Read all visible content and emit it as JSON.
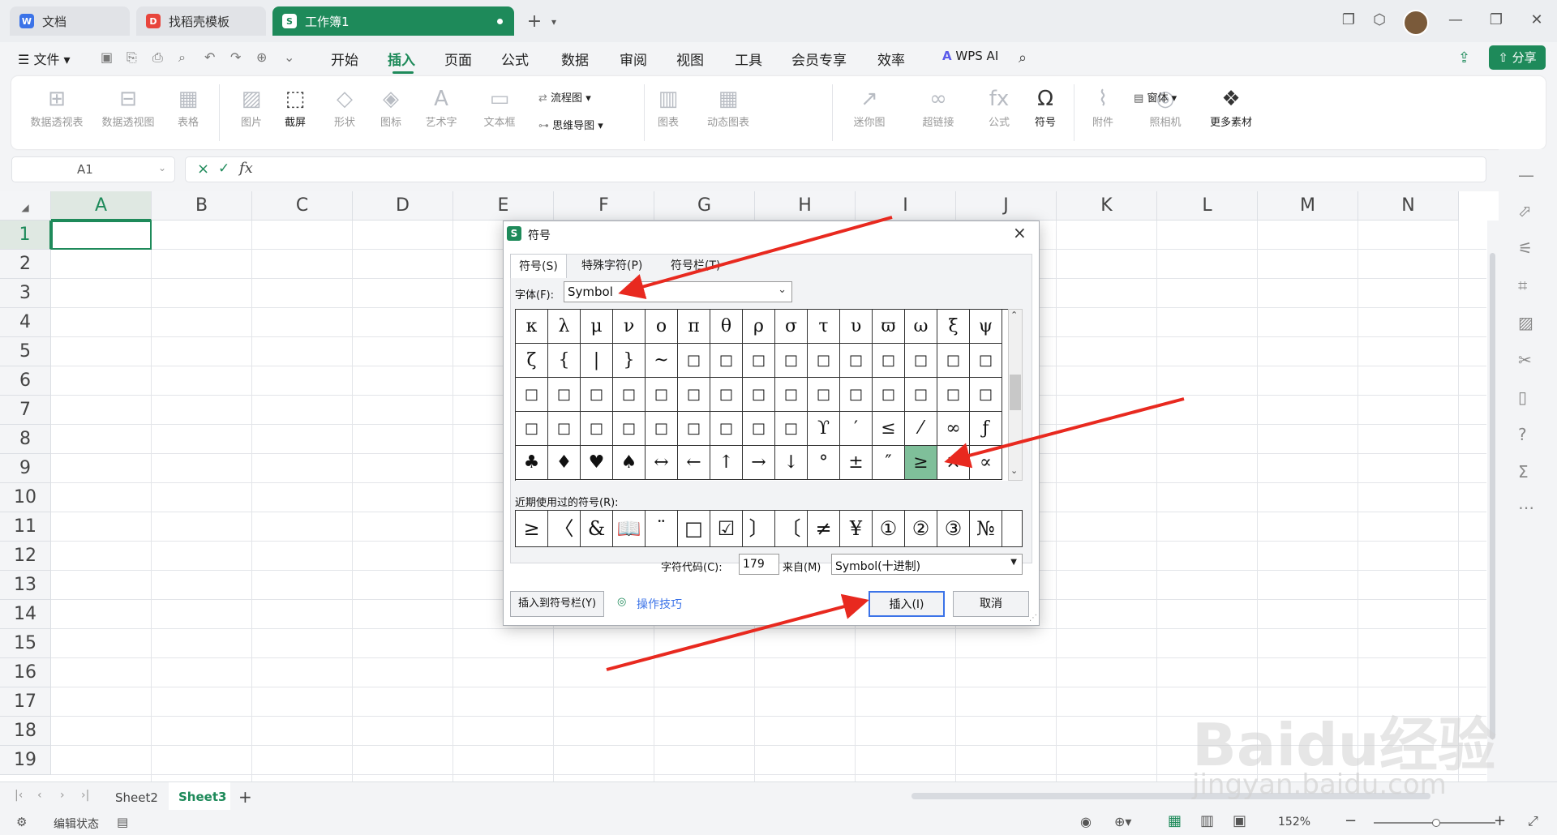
{
  "window": {
    "tabs": [
      {
        "label": "文档",
        "icon_color": "#3b73e8",
        "icon_text": "W"
      },
      {
        "label": "找稻壳模板",
        "icon_color": "#e8453c",
        "icon_text": "D"
      },
      {
        "label": "工作簿1",
        "icon_color": "#1e8a5a",
        "icon_text": "S"
      }
    ],
    "new_tab": "+"
  },
  "menu": {
    "file": "文件",
    "items": [
      "开始",
      "插入",
      "页面",
      "公式",
      "数据",
      "审阅",
      "视图",
      "工具",
      "会员专享",
      "效率"
    ],
    "active": "插入",
    "wps_ai": "WPS AI",
    "share": "分享"
  },
  "ribbon": {
    "buttons": [
      "数据透视表",
      "数据透视图",
      "表格",
      "图片",
      "截屏",
      "形状",
      "图标",
      "艺术字",
      "文本框",
      "图表",
      "动态图表",
      "迷你图",
      "超链接",
      "公式",
      "符号",
      "附件",
      "照相机",
      "更多素材"
    ],
    "small": [
      "流程图",
      "思维导图",
      "窗体"
    ]
  },
  "formula_bar": {
    "cell_ref": "A1",
    "fx": "fx",
    "cancel": "×",
    "confirm": "✓"
  },
  "grid": {
    "columns": [
      "A",
      "B",
      "C",
      "D",
      "E",
      "F",
      "G",
      "H",
      "I",
      "J",
      "K",
      "L",
      "M",
      "N"
    ],
    "rows": [
      "1",
      "2",
      "3",
      "4",
      "5",
      "6",
      "7",
      "8",
      "9",
      "10",
      "11",
      "12",
      "13",
      "14",
      "15",
      "16",
      "17",
      "18",
      "19"
    ]
  },
  "sheets": {
    "tabs": [
      "Sheet2",
      "Sheet3"
    ],
    "active": "Sheet3",
    "add": "+"
  },
  "status": {
    "mode": "编辑状态",
    "zoom": "152%"
  },
  "dialog": {
    "title": "符号",
    "tabs": [
      "符号(S)",
      "特殊字符(P)",
      "符号栏(T)"
    ],
    "font_label": "字体(F):",
    "font_value": "Symbol",
    "symbols": [
      [
        "κ",
        "λ",
        "μ",
        "ν",
        "ο",
        "π",
        "θ",
        "ρ",
        "σ",
        "τ",
        "υ",
        "ϖ",
        "ω",
        "ξ",
        "ψ"
      ],
      [
        "ζ",
        "{",
        "|",
        "}",
        "~",
        "□",
        "□",
        "□",
        "□",
        "□",
        "□",
        "□",
        "□",
        "□",
        "□"
      ],
      [
        "□",
        "□",
        "□",
        "□",
        "□",
        "□",
        "□",
        "□",
        "□",
        "□",
        "□",
        "□",
        "□",
        "□",
        "□"
      ],
      [
        "□",
        "□",
        "□",
        "□",
        "□",
        "□",
        "□",
        "□",
        "□",
        "ϒ",
        "′",
        "≤",
        "⁄",
        "∞",
        "ƒ"
      ],
      [
        "♣",
        "♦",
        "♥",
        "♠",
        "↔",
        "←",
        "↑",
        "→",
        "↓",
        "°",
        "±",
        "″",
        "≥",
        "×",
        "∝"
      ]
    ],
    "selected_symbol": "≥",
    "recent_label": "近期使用过的符号(R):",
    "recent": [
      "≥",
      "〈",
      "&",
      "📖",
      "¨",
      "□",
      "☑",
      "〕",
      "〔",
      "≠",
      "¥",
      "①",
      "②",
      "③",
      "№"
    ],
    "code_label": "字符代码(C):",
    "code_value": "179",
    "from_label": "来自(M)",
    "from_value": "Symbol(十进制)",
    "add_to_bar": "插入到符号栏(Y)",
    "tips": "操作技巧",
    "insert": "插入(I)",
    "cancel": "取消"
  },
  "watermark": {
    "brand": "Baidu经验",
    "url": "jingyan.baidu.com"
  },
  "colors": {
    "accent": "#1e8a5a",
    "arrow": "#e8291f"
  }
}
